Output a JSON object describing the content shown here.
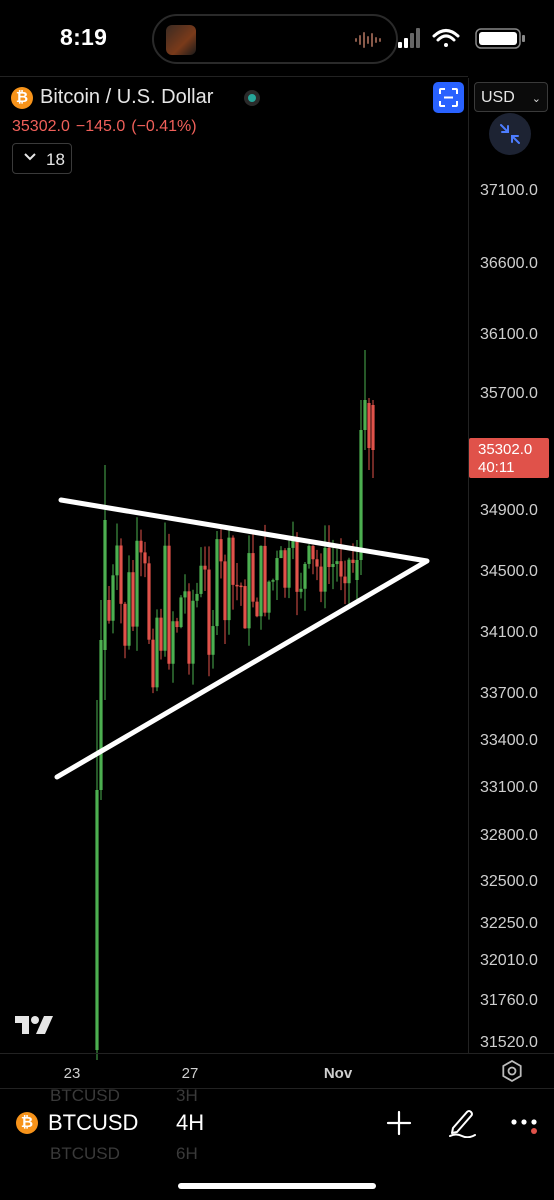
{
  "status_bar": {
    "time": "8:19"
  },
  "header": {
    "coin_icon_glyph": "₿",
    "pair_title": "Bitcoin / U.S. Dollar",
    "market_status_color": "#26a69a",
    "currency": "USD",
    "last_price": "35302.0",
    "change": "−145.0",
    "change_pct": "(−0.41%)",
    "collapsed_indicators_count": "18"
  },
  "price_axis": {
    "ticks": [
      "37100.0",
      "36600.0",
      "36100.0",
      "35700.0",
      "34900.0",
      "34500.0",
      "34100.0",
      "33700.0",
      "33400.0",
      "33100.0",
      "32800.0",
      "32500.0",
      "32250.0",
      "32010.0",
      "31760.0",
      "31520.0"
    ],
    "last_price_label": "35302.0",
    "countdown": "40:11"
  },
  "time_axis": {
    "ticks": [
      "23",
      "27",
      "Nov"
    ]
  },
  "colors": {
    "up": "#4caf50",
    "down": "#e0524a",
    "background": "#000000",
    "accent": "#2962ff",
    "bitcoin": "#f7931a"
  },
  "toolbar": {
    "symbol": "BTCUSD",
    "interval": "4H",
    "ghost_above_interval": "3H",
    "ghost_below_interval": "6H",
    "ghost_symbol": "BTCUSD"
  },
  "icons": [
    "bitcoin-icon",
    "fullscreen-icon",
    "chevron-down-icon",
    "compress-icon",
    "tradingview-logo",
    "gear-icon",
    "plus-icon",
    "pen-icon",
    "more-icon"
  ]
}
